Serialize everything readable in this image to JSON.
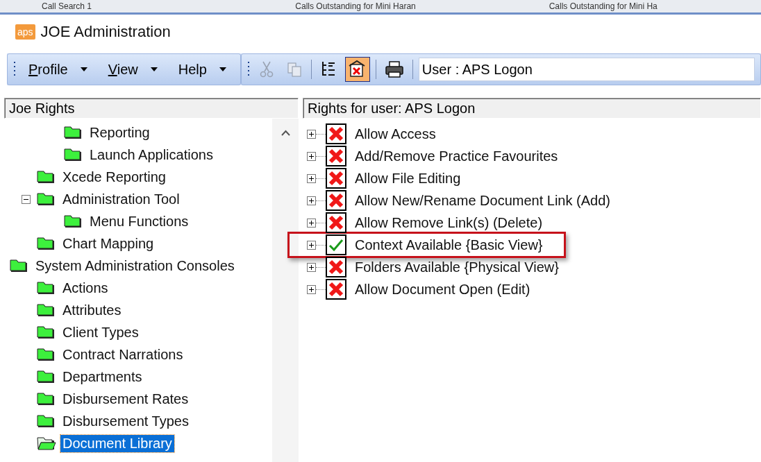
{
  "background_tabs": [
    {
      "label": "Call Search 1"
    },
    {
      "label": "Calls Outstanding for Mini Haran"
    },
    {
      "label": "Calls Outstanding for Mini Ha"
    }
  ],
  "window": {
    "logo": "aps",
    "title": "JOE Administration"
  },
  "menu": [
    {
      "label": "Profile",
      "underline_first": true
    },
    {
      "label": "View",
      "underline_first": true
    },
    {
      "label": "Help",
      "underline_first": false
    }
  ],
  "toolbar": [
    {
      "kind": "cut",
      "disabled": true,
      "selected": false
    },
    {
      "kind": "copy",
      "disabled": true,
      "selected": false
    },
    {
      "kind": "tree",
      "disabled": false,
      "selected": false
    },
    {
      "kind": "rights",
      "disabled": false,
      "selected": true
    },
    {
      "kind": "print",
      "disabled": false,
      "selected": false
    }
  ],
  "user_field": {
    "value": "User : APS Logon"
  },
  "left_panel": {
    "title": "Joe Rights",
    "tree": [
      {
        "children": [
          {
            "children": [
              {
                "label": "Reporting",
                "selected": false
              },
              {
                "label": "Launch Applications",
                "selected": false
              }
            ]
          },
          {
            "label": "Xcede Reporting",
            "selected": false
          },
          {
            "label": "Administration Tool",
            "selected": false,
            "expanded": true,
            "children": [
              {
                "label": "Menu Functions",
                "selected": false
              }
            ]
          },
          {
            "label": "Chart Mapping",
            "selected": false
          }
        ]
      },
      {
        "label": "System Administration Consoles",
        "selected": false,
        "children": [
          {
            "label": "Actions",
            "selected": false
          },
          {
            "label": "Attributes",
            "selected": false
          },
          {
            "label": "Client Types",
            "selected": false
          },
          {
            "label": "Contract Narrations",
            "selected": false
          },
          {
            "label": "Departments",
            "selected": false
          },
          {
            "label": "Disbursement Rates",
            "selected": false
          },
          {
            "label": "Disbursement Types",
            "selected": false
          },
          {
            "label": "Document Library",
            "selected": true
          }
        ]
      }
    ]
  },
  "right_panel": {
    "title": "Rights for user: APS Logon",
    "rights": [
      {
        "label": "Allow Access",
        "allowed": false,
        "highlighted": false
      },
      {
        "label": "Add/Remove Practice Favourites",
        "allowed": false,
        "highlighted": false
      },
      {
        "label": "Allow File Editing",
        "allowed": false,
        "highlighted": false
      },
      {
        "label": "Allow New/Rename Document Link (Add)",
        "allowed": false,
        "highlighted": false
      },
      {
        "label": "Allow Remove Link(s) (Delete)",
        "allowed": false,
        "highlighted": false
      },
      {
        "label": "Context Available {Basic View}",
        "allowed": true,
        "highlighted": true
      },
      {
        "label": "Folders Available {Physical View}",
        "allowed": false,
        "highlighted": false
      },
      {
        "label": "Allow Document Open (Edit)",
        "allowed": false,
        "highlighted": false
      }
    ]
  }
}
